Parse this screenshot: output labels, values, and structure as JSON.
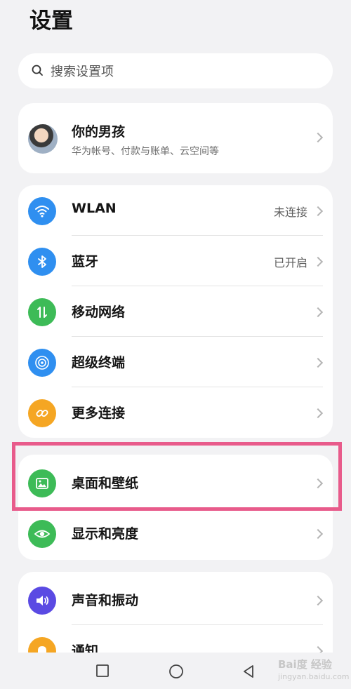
{
  "header": {
    "title": "设置"
  },
  "search": {
    "placeholder": "搜索设置项",
    "icon": "search-icon"
  },
  "account": {
    "name": "你的男孩",
    "subtitle": "华为帐号、付款与账单、云空间等"
  },
  "connections": [
    {
      "label": "WLAN",
      "value": "未连接",
      "icon": "wifi-icon",
      "color": "#2f8ff0"
    },
    {
      "label": "蓝牙",
      "value": "已开启",
      "icon": "bluetooth-icon",
      "color": "#2f8ff0"
    },
    {
      "label": "移动网络",
      "value": "",
      "icon": "mobile-network-icon",
      "color": "#3dbb57"
    },
    {
      "label": "超级终端",
      "value": "",
      "icon": "super-device-icon",
      "color": "#2f8ff0"
    },
    {
      "label": "更多连接",
      "value": "",
      "icon": "link-icon",
      "color": "#f5a623"
    }
  ],
  "display": [
    {
      "label": "桌面和壁纸",
      "icon": "wallpaper-icon",
      "color": "#3dbb57"
    },
    {
      "label": "显示和亮度",
      "icon": "eye-icon",
      "color": "#3dbb57"
    }
  ],
  "sound": [
    {
      "label": "声音和振动",
      "icon": "speaker-icon",
      "color": "#5a4ae3"
    },
    {
      "label": "通知",
      "icon": "bell-icon",
      "color": "#f5a623"
    }
  ],
  "watermark": {
    "line1": "Bai度 经验",
    "line2": "jingyan.baidu.com"
  },
  "accent_highlight": "#e85b8b"
}
